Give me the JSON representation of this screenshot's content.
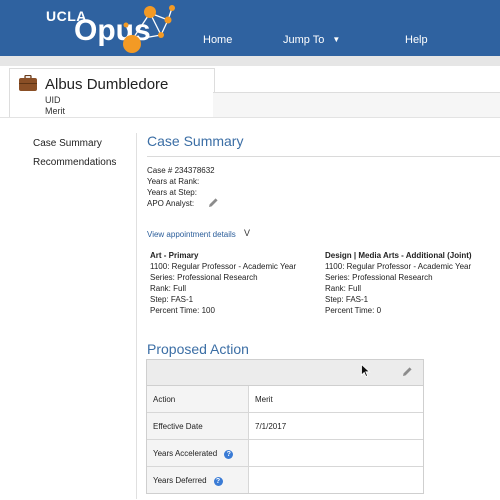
{
  "brand": {
    "ucla": "UCLA",
    "opus": "Opus"
  },
  "nav": {
    "home": "Home",
    "jump_to": "Jump To",
    "help": "Help"
  },
  "person": {
    "name": "Albus Dumbledore",
    "uid": "UID",
    "action": "Merit"
  },
  "sidebar": {
    "items": [
      {
        "label": "Case Summary"
      },
      {
        "label": "Recommendations"
      }
    ]
  },
  "case_summary": {
    "title": "Case Summary",
    "case_number": "Case # 234378632",
    "years_at_rank": "Years at Rank:",
    "years_at_step": "Years at Step:",
    "apo_analyst": "APO Analyst:",
    "view_details": "View appointment details",
    "toggle": "V"
  },
  "appointments": [
    {
      "title": "Art - Primary",
      "title_code": "1100: Regular Professor - Academic Year",
      "series": "Series: Professional Research",
      "rank": "Rank: Full",
      "step": "Step: FAS-1",
      "percent": "Percent Time: 100"
    },
    {
      "title": "Design | Media Arts - Additional (Joint)",
      "title_code": "1100: Regular Professor - Academic Year",
      "series": "Series: Professional Research",
      "rank": "Rank: Full",
      "step": "Step: FAS-1",
      "percent": "Percent Time: 0"
    }
  ],
  "proposed_action": {
    "title": "Proposed Action",
    "rows": [
      {
        "label": "Action",
        "value": "Merit"
      },
      {
        "label": "Effective Date",
        "value": "7/1/2017"
      },
      {
        "label": "Years Accelerated",
        "value": ""
      },
      {
        "label": "Years Deferred",
        "value": ""
      }
    ]
  },
  "icons": {
    "edit": "pencil-icon",
    "help": "question-circle-icon",
    "briefcase": "briefcase-icon",
    "cursor": "mouse-cursor-icon"
  },
  "colors": {
    "header": "#2f62a0",
    "accent": "#3b6ea5",
    "logo_orange": "#f39a25",
    "help_blue": "#3a7bd5"
  }
}
